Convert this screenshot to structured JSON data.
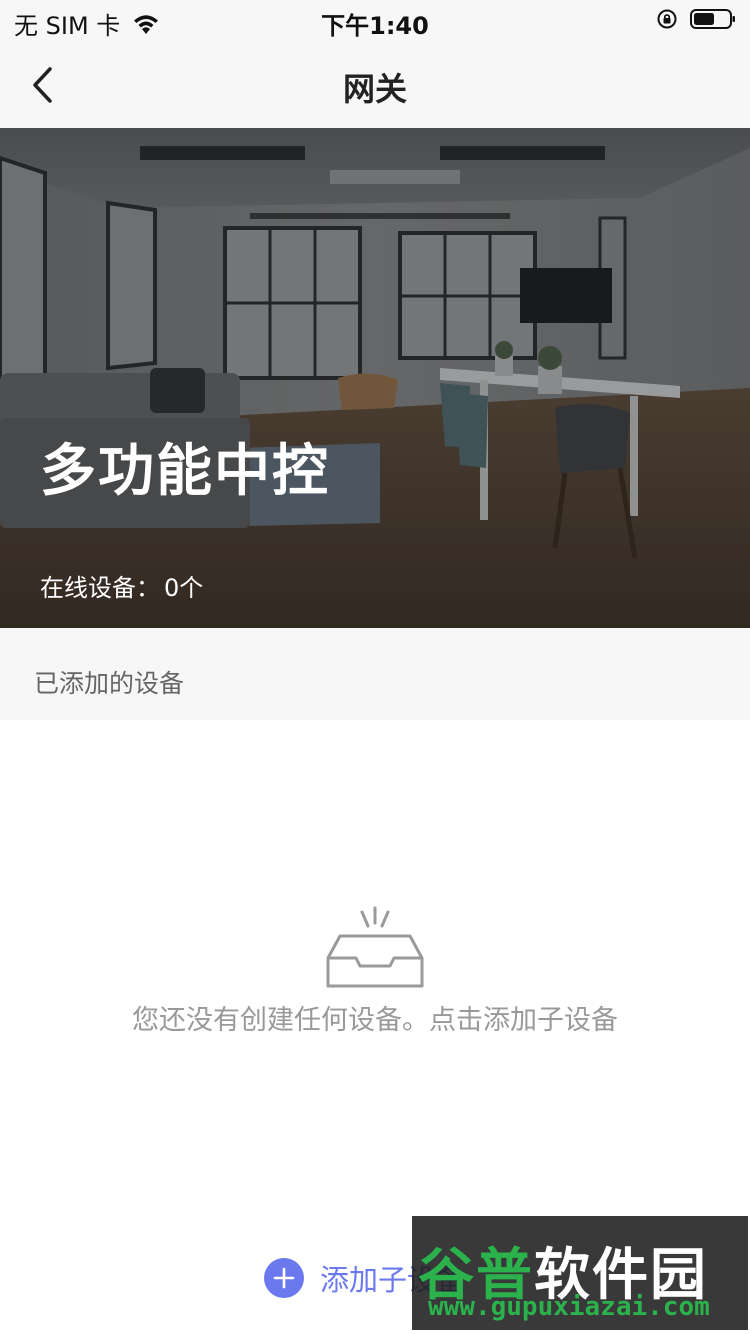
{
  "status_bar": {
    "carrier": "无 SIM 卡",
    "time": "下午1:40"
  },
  "nav": {
    "title": "网关"
  },
  "hero": {
    "title": "多功能中控",
    "online_label": "在线设备：",
    "online_count": "0个"
  },
  "section": {
    "title": "已添加的设备"
  },
  "empty_state": {
    "message": "您还没有创建任何设备。点击添加子设备"
  },
  "actions": {
    "add_sub_device": "添加子设备"
  },
  "watermark": {
    "logo_part1": "谷普",
    "logo_part2": "软件园",
    "url": "www.gupuxiazai.com"
  },
  "colors": {
    "accent": "#6b79ef",
    "background_gray": "#f7f7f7"
  }
}
